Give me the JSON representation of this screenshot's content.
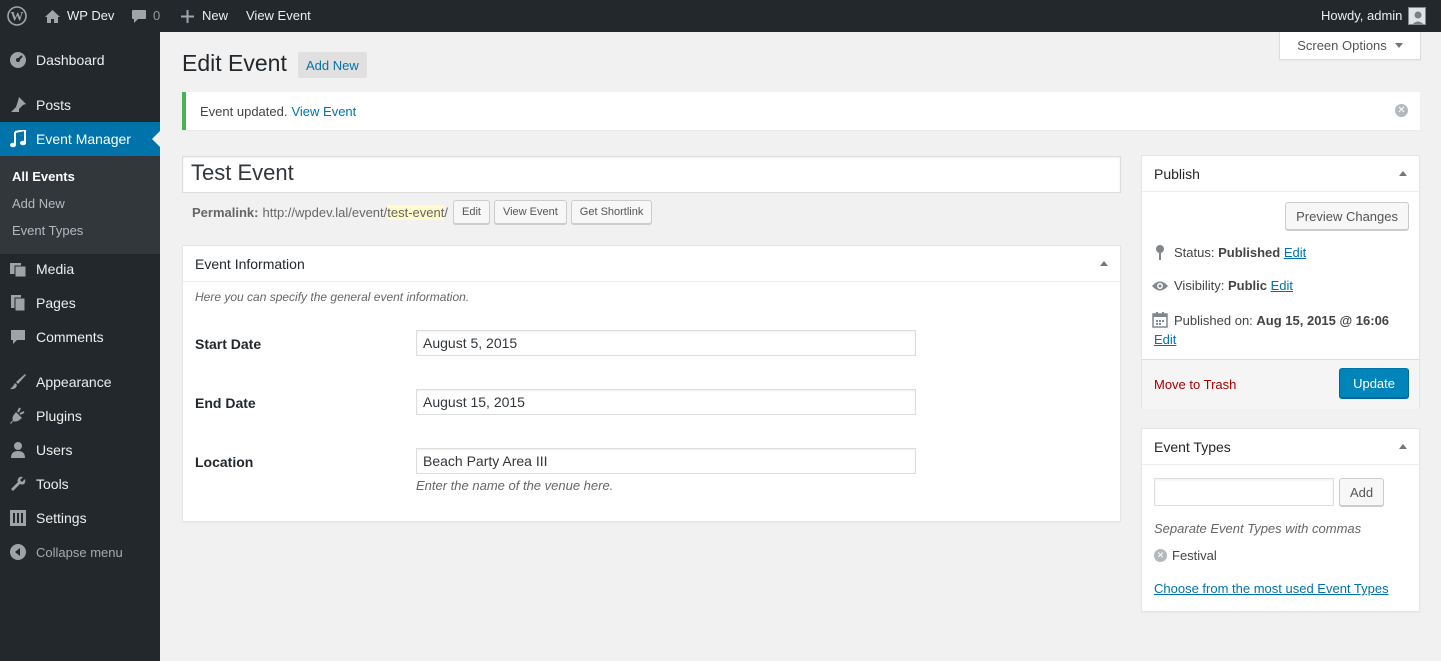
{
  "adminbar": {
    "site_name": "WP Dev",
    "comments_count": "0",
    "new_label": "New",
    "view_label": "View Event",
    "howdy": "Howdy, admin"
  },
  "sidebar": {
    "items": [
      {
        "label": "Dashboard",
        "icon": "dashboard-icon"
      },
      {
        "label": "Posts",
        "icon": "pin-icon"
      },
      {
        "label": "Event Manager",
        "icon": "music-note-icon"
      },
      {
        "label": "Media",
        "icon": "media-icon"
      },
      {
        "label": "Pages",
        "icon": "pages-icon"
      },
      {
        "label": "Comments",
        "icon": "comment-icon"
      },
      {
        "label": "Appearance",
        "icon": "brush-icon"
      },
      {
        "label": "Plugins",
        "icon": "plug-icon"
      },
      {
        "label": "Users",
        "icon": "user-icon"
      },
      {
        "label": "Tools",
        "icon": "wrench-icon"
      },
      {
        "label": "Settings",
        "icon": "settings-icon"
      }
    ],
    "submenu": [
      "All Events",
      "Add New",
      "Event Types"
    ],
    "collapse_label": "Collapse menu"
  },
  "screen_options": "Screen Options",
  "page": {
    "title": "Edit Event",
    "add_new": "Add New"
  },
  "notice": {
    "text": "Event updated.",
    "link": "View Event"
  },
  "post": {
    "title": "Test Event",
    "permalink_label": "Permalink:",
    "permalink_base": "http://wpdev.lal/event/",
    "permalink_slug": "test-event",
    "permalink_end": "/",
    "edit_btn": "Edit",
    "view_btn": "View Event",
    "shortlink_btn": "Get Shortlink"
  },
  "event_info": {
    "title": "Event Information",
    "description": "Here you can specify the general event information.",
    "start_label": "Start Date",
    "start_value": "August 5, 2015",
    "end_label": "End Date",
    "end_value": "August 15, 2015",
    "location_label": "Location",
    "location_value": "Beach Party Area III",
    "location_hint": "Enter the name of the venue here."
  },
  "publish": {
    "title": "Publish",
    "preview_btn": "Preview Changes",
    "status_label": "Status:",
    "status_value": "Published",
    "visibility_label": "Visibility:",
    "visibility_value": "Public",
    "published_label": "Published on:",
    "published_value": "Aug 15, 2015 @ 16:06",
    "edit_link": "Edit",
    "trash_link": "Move to Trash",
    "update_btn": "Update"
  },
  "event_types": {
    "title": "Event Types",
    "add_btn": "Add",
    "hint": "Separate Event Types with commas",
    "tag": "Festival",
    "choose_link": "Choose from the most used Event Types"
  },
  "colors": {
    "sidebar_bg": "#23282d",
    "accent": "#0073aa",
    "success": "#46b450",
    "primary_btn": "#0085ba"
  }
}
